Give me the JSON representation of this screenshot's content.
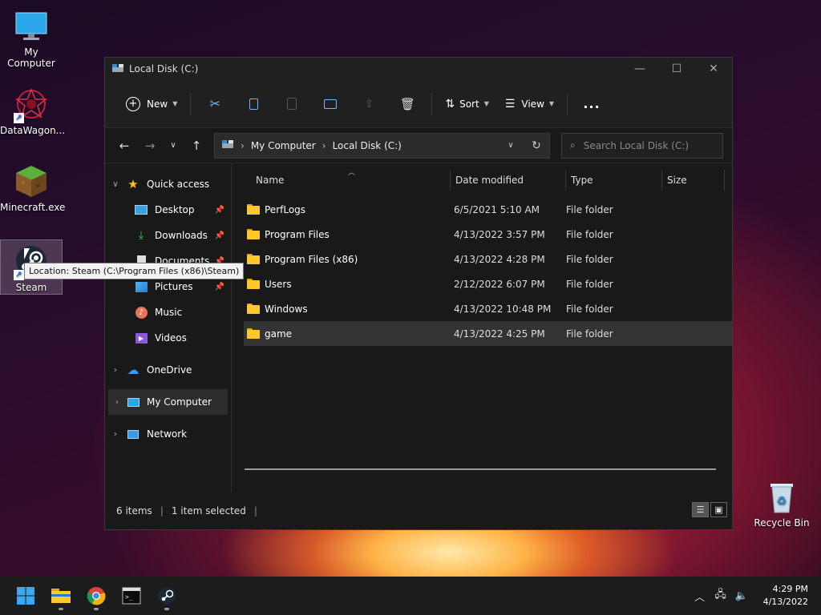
{
  "desktop": {
    "icons": [
      {
        "label": "My Computer"
      },
      {
        "label": "DataWagon..."
      },
      {
        "label": "Minecraft.exe"
      },
      {
        "label": "Steam"
      },
      {
        "label": "Recycle Bin"
      }
    ],
    "tooltip": "Location: Steam (C:\\Program Files (x86)\\Steam)"
  },
  "window": {
    "title": "Local Disk (C:)",
    "toolbar": {
      "new_label": "New",
      "sort_label": "Sort",
      "view_label": "View",
      "more_label": "..."
    },
    "address": {
      "crumbs": [
        "My Computer",
        "Local Disk (C:)"
      ]
    },
    "search": {
      "placeholder": "Search Local Disk (C:)"
    },
    "sidebar": {
      "quick_access": "Quick access",
      "items": [
        "Desktop",
        "Downloads",
        "Documents",
        "Pictures",
        "Music",
        "Videos"
      ],
      "onedrive": "OneDrive",
      "my_computer": "My Computer",
      "network": "Network"
    },
    "columns": {
      "name": "Name",
      "date": "Date modified",
      "type": "Type",
      "size": "Size"
    },
    "files": [
      {
        "name": "PerfLogs",
        "date": "6/5/2021 5:10 AM",
        "type": "File folder"
      },
      {
        "name": "Program Files",
        "date": "4/13/2022 3:57 PM",
        "type": "File folder"
      },
      {
        "name": "Program Files (x86)",
        "date": "4/13/2022 4:28 PM",
        "type": "File folder"
      },
      {
        "name": "Users",
        "date": "2/12/2022 6:07 PM",
        "type": "File folder"
      },
      {
        "name": "Windows",
        "date": "4/13/2022 10:48 PM",
        "type": "File folder"
      },
      {
        "name": "game",
        "date": "4/13/2022 4:25 PM",
        "type": "File folder"
      }
    ],
    "status": {
      "items": "6 items",
      "selected": "1 item selected"
    }
  },
  "taskbar": {
    "time": "4:29 PM",
    "date": "4/13/2022"
  }
}
